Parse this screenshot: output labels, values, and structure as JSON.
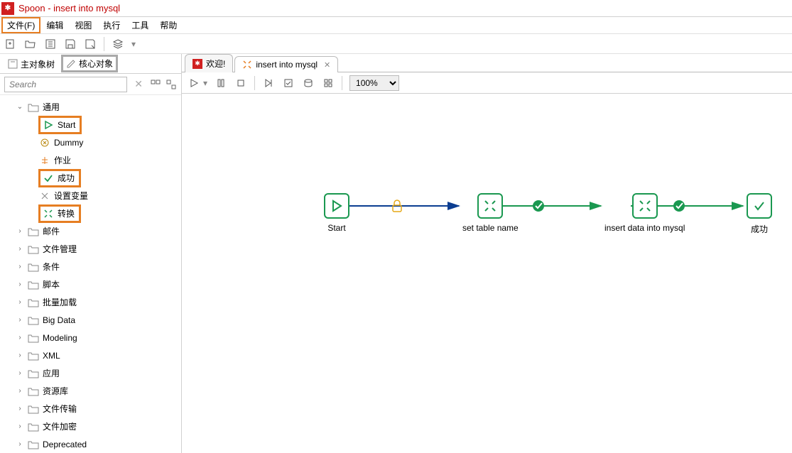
{
  "titlebar": {
    "title": "Spoon - insert into mysql"
  },
  "menubar": [
    "文件(F)",
    "编辑",
    "视图",
    "执行",
    "工具",
    "帮助"
  ],
  "side_tabs": {
    "a": "主对象树",
    "b": "核心对象"
  },
  "search": {
    "placeholder": "Search"
  },
  "tree": {
    "general": "通用",
    "general_children": [
      "Start",
      "Dummy",
      "作业",
      "成功",
      "设置变量",
      "转换"
    ],
    "folders": [
      "邮件",
      "文件管理",
      "条件",
      "脚本",
      "批量加载",
      "Big Data",
      "Modeling",
      "XML",
      "应用",
      "资源库",
      "文件传输",
      "文件加密",
      "Deprecated"
    ]
  },
  "canvas_tabs": {
    "welcome": "欢迎!",
    "job": "insert into mysql"
  },
  "zoom": "100%",
  "flow": {
    "n1": "Start",
    "n2": "set table name",
    "n3": "insert data into mysql",
    "n4": "成功"
  }
}
